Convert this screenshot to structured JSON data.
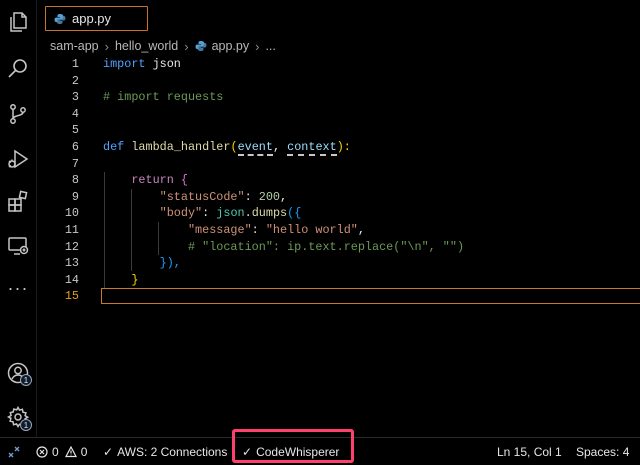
{
  "tab": {
    "label": "app.py"
  },
  "breadcrumb": {
    "items": [
      "sam-app",
      "hello_world",
      "app.py",
      "..."
    ]
  },
  "editor": {
    "line_numbers": [
      "1",
      "2",
      "3",
      "4",
      "5",
      "6",
      "7",
      "8",
      "9",
      "10",
      "11",
      "12",
      "13",
      "14",
      "15"
    ],
    "active_line": "15",
    "code": {
      "l1": {
        "kw": "import",
        "rest": " json"
      },
      "l3": {
        "comment": "# import requests"
      },
      "l6": {
        "kw": "def",
        "name": "lambda_handler",
        "open": "(",
        "p1": "event",
        "comma": ", ",
        "p2": "context",
        "close": "):"
      },
      "l8": {
        "kw": "return",
        "brace": "{"
      },
      "l9": {
        "key": "\"statusCode\"",
        "colon": ": ",
        "num": "200",
        "comma": ","
      },
      "l10": {
        "key": "\"body\"",
        "colon": ": ",
        "mod": "json",
        "dot": ".",
        "fn": "dumps",
        "open": "({"
      },
      "l11": {
        "key": "\"message\"",
        "colon": ": ",
        "val": "\"hello world\"",
        "comma": ","
      },
      "l12": {
        "comment": "# \"location\": ip.text.replace(\"\\n\", \"\")"
      },
      "l13": {
        "close": "}),",
        "paren_close": ")"
      },
      "l14": {
        "brace": "}"
      }
    }
  },
  "statusbar": {
    "problems_errors": "0",
    "problems_warnings": "0",
    "aws": "AWS: 2 Connections",
    "codewhisperer": "CodeWhisperer",
    "position": "Ln 15, Col 1",
    "spaces": "Spaces: 4"
  },
  "activity_badges": {
    "accounts": "1",
    "settings": "1"
  },
  "colors": {
    "accent_tab_border": "#c9722b",
    "highlight_box": "#ff3f6e",
    "keyword": "#4fa1ff",
    "string": "#ce9178",
    "comment": "#6a9955"
  },
  "icons": [
    "explorer-icon",
    "search-icon",
    "source-control-icon",
    "run-debug-icon",
    "extensions-icon",
    "remote-explorer-icon",
    "more-icon",
    "accounts-icon",
    "settings-gear-icon",
    "python-file-icon",
    "remote-indicator-icon",
    "error-icon",
    "warning-icon",
    "check-icon"
  ]
}
